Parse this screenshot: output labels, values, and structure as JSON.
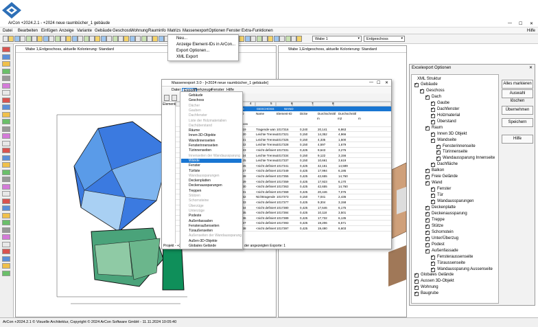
{
  "app": {
    "title": "ArCon +2024.2.1 - +2024 neue raumbücher_1 gebäude",
    "status": "ArCon +2024.2.1 © Visuelle Architektur, Copyright © 2024 ArCon Software GmbH  -  11.11.2024 10:05:40",
    "help": "Hilfe"
  },
  "menu": [
    "Datei",
    "Bearbeiten",
    "Einfügen",
    "Anzeige",
    "Variante",
    "Gebäude",
    "Geschoss",
    "Wohnung",
    "Rauminfo",
    "Matrizs",
    "Massenexport",
    "Optionen",
    "Fenster",
    "Extra-Funktionen"
  ],
  "massenexport_menu": [
    "Neu...",
    "Anzeige Element-IDs in ArCon...",
    "Export Optionen...",
    "XML Export"
  ],
  "toolbar": {
    "wabe": "Wabe 1",
    "geschoss": "Erdgeschoss"
  },
  "left_view": {
    "title": "Wabe 1,Erdgeschoss, aktuelle Kolorierung: Standard"
  },
  "right_view": {
    "title": "Wabe 1,Erdgeschoss, aktuelle Kolorierung: Standard"
  },
  "mass_window": {
    "title": "Massenexport 3.0 - [+2024 neue raumbücher_1 gebäude]",
    "menu": [
      "Datei",
      "Export",
      "Werkzeuge",
      "Fenster",
      "Hilfe"
    ],
    "side_label": "Elemente",
    "bottom_left": "Projekt - +2024",
    "bottom_status": "der angezeigten Exporte: 1",
    "export_items": [
      {
        "label": "Gebäude",
        "grey": false
      },
      {
        "label": "Geschoss",
        "grey": false
      },
      {
        "label": "Dächer",
        "grey": true
      },
      {
        "label": "Gauben",
        "grey": true
      },
      {
        "label": "Dachfenster",
        "grey": true
      },
      {
        "label": "Liste der Holzmaterialien",
        "grey": true
      },
      {
        "label": "Dachüberstand",
        "grey": true
      },
      {
        "label": "Räume",
        "grey": false
      },
      {
        "label": "Innen-3D-Objekte",
        "grey": false
      },
      {
        "label": "Wandinnenseiten",
        "grey": false
      },
      {
        "label": "Fensterinnenseiten",
        "grey": false
      },
      {
        "label": "Türinnenseiten",
        "grey": false
      },
      {
        "label": "Innenseiten der Wandaussparung",
        "grey": true
      },
      {
        "label": "Wände",
        "grey": false,
        "selected": true
      },
      {
        "label": "Fenster",
        "grey": false
      },
      {
        "label": "Türliste",
        "grey": false
      },
      {
        "label": "Wandaussparungen",
        "grey": true
      },
      {
        "label": "Deckenplatten",
        "grey": false
      },
      {
        "label": "Deckenaussparungen",
        "grey": false
      },
      {
        "label": "Treppen",
        "grey": false
      },
      {
        "label": "Stützen",
        "grey": true
      },
      {
        "label": "Schornsteine",
        "grey": true
      },
      {
        "label": "Überzüge",
        "grey": true
      },
      {
        "label": "Unterzüge",
        "grey": true
      },
      {
        "label": "Podeste",
        "grey": false
      },
      {
        "label": "Außenfassaden",
        "grey": false
      },
      {
        "label": "Fensteraußenseiten",
        "grey": false
      },
      {
        "label": "Türaußenseiten",
        "grey": false
      },
      {
        "label": "Außenseiten der Wandaussparung",
        "grey": true
      },
      {
        "label": "Außen-3D-Objekte",
        "grey": false
      },
      {
        "label": "Globales Gelände",
        "grey": false
      }
    ],
    "col_numbers": [
      "3",
      "4",
      "5",
      "6",
      "7",
      "8"
    ],
    "header_row": [
      "GEBÄUDE",
      "GESCHOSS",
      "WAND"
    ],
    "name_row": [
      "Name",
      "Name",
      "ID",
      "Name",
      "Element-ID",
      "Dicke",
      "Durchschnittl",
      "Durchschnittl"
    ],
    "unit_row": [
      "m",
      "m2",
      "m"
    ],
    "rows": [
      [
        "Erdgeschoss",
        "",
        "",
        "",
        "",
        ""
      ],
      [
        "419",
        "Tragende wan",
        "1017316",
        "0,240",
        "20,141",
        "6,863"
      ],
      [
        "420",
        "Leichte Trennw",
        "1017321",
        "0,150",
        "14,352",
        "4,966"
      ],
      [
        "421",
        "Leichte Trennw",
        "1017325",
        "0,150",
        "4,335",
        "1,500"
      ],
      [
        "422",
        "Leichte Trennw",
        "1017328",
        "0,150",
        "4,597",
        "1,679"
      ],
      [
        "423",
        "<nicht definiert",
        "1017331",
        "0,425",
        "9,643",
        "3,276"
      ],
      [
        "424",
        "Leichte Trennw",
        "1017334",
        "0,150",
        "9,122",
        "3,156"
      ],
      [
        "425",
        "Leichte Trennw",
        "1017337",
        "0,150",
        "10,661",
        "3,619"
      ],
      [
        "426",
        "<nicht definiert",
        "1017341",
        "0,425",
        "42,161",
        "14,589"
      ],
      [
        "427",
        "<nicht definiert",
        "1017349",
        "0,425",
        "17,994",
        "6,195"
      ],
      [
        "428",
        "<nicht definiert",
        "1017355",
        "0,425",
        "42,655",
        "14,760"
      ],
      [
        "429",
        "<nicht definiert",
        "1017359",
        "0,425",
        "17,923",
        "6,170"
      ],
      [
        "430",
        "<nicht definiert",
        "1017363",
        "0,425",
        "42,655",
        "14,760"
      ],
      [
        "431",
        "<nicht definiert",
        "1017369",
        "0,425",
        "20,446",
        "7,075"
      ],
      [
        "432",
        "Nichttragende",
        "1017373",
        "0,150",
        "7,041",
        "2,436"
      ],
      [
        "433",
        "<nicht definiert",
        "1017377",
        "0,425",
        "9,304",
        "3,158"
      ],
      [
        "434",
        "<nicht definiert",
        "1017380",
        "0,425",
        "17,646",
        "6,175"
      ],
      [
        "435",
        "<nicht definiert",
        "1017384",
        "0,425",
        "10,118",
        "3,501"
      ],
      [
        "436",
        "<nicht definiert",
        "1017389",
        "0,425",
        "17,732",
        "6,135"
      ],
      [
        "437",
        "<nicht definiert",
        "1017393",
        "0,425",
        "19,206",
        "6,571"
      ],
      [
        "438",
        "<nicht definiert",
        "1017397",
        "0,425",
        "19,490",
        "6,603"
      ]
    ]
  },
  "excel_panel": {
    "title": "Excelexport Optionen",
    "root": "XML Struktur",
    "buttons": [
      "Alles markieren",
      "Auswahl löschen",
      "Übernehmen",
      "Speichern",
      "Hilfe"
    ],
    "tree": [
      {
        "label": "Gebäude",
        "level": 0
      },
      {
        "label": "Geschoss",
        "level": 1
      },
      {
        "label": "Dach",
        "level": 2
      },
      {
        "label": "Gaube",
        "level": 3
      },
      {
        "label": "Dachfenster",
        "level": 3
      },
      {
        "label": "Holzmaterial",
        "level": 3
      },
      {
        "label": "Überstand",
        "level": 3
      },
      {
        "label": "Raum",
        "level": 2
      },
      {
        "label": "Innen 3D Objekt",
        "level": 3
      },
      {
        "label": "Wandseite",
        "level": 3
      },
      {
        "label": "Fensterinnenseite",
        "level": 4
      },
      {
        "label": "Türinnenseite",
        "level": 4
      },
      {
        "label": "Wandaussparung Innenseite",
        "level": 4
      },
      {
        "label": "Dachfläche",
        "level": 3
      },
      {
        "label": "Balkon",
        "level": 2
      },
      {
        "label": "Freie Gelände",
        "level": 2
      },
      {
        "label": "Wand",
        "level": 2
      },
      {
        "label": "Fenster",
        "level": 3
      },
      {
        "label": "Tür",
        "level": 3
      },
      {
        "label": "Wandaussparungen",
        "level": 3
      },
      {
        "label": "Deckenplatte",
        "level": 2
      },
      {
        "label": "Deckenaussparung",
        "level": 2
      },
      {
        "label": "Treppe",
        "level": 2
      },
      {
        "label": "Stütze",
        "level": 2
      },
      {
        "label": "Schornstein",
        "level": 2
      },
      {
        "label": "Unter/Überzug",
        "level": 2
      },
      {
        "label": "Podest",
        "level": 2
      },
      {
        "label": "Außenfassade",
        "level": 2
      },
      {
        "label": "Fensteraussenseite",
        "level": 3
      },
      {
        "label": "Türaussenseite",
        "level": 3
      },
      {
        "label": "Wandaussparung Aussenseite",
        "level": 3
      },
      {
        "label": "Globales Gelände",
        "level": 0
      },
      {
        "label": "Aussen 3D-Objekt",
        "level": 0
      },
      {
        "label": "Wohnung",
        "level": 0
      },
      {
        "label": "Baugrube",
        "level": 0
      }
    ]
  },
  "colors": {
    "selection": "#1976d2",
    "plan_blue": "#2f6fd6",
    "plan_green": "#5aa072"
  }
}
